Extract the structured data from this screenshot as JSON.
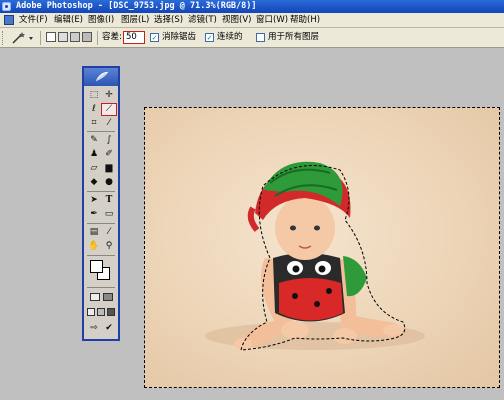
{
  "window": {
    "title": "Adobe Photoshop - [DSC_9753.jpg @ 71.3%(RGB/8)]"
  },
  "menu": [
    {
      "label": "文件(F)"
    },
    {
      "label": "编辑(E)"
    },
    {
      "label": "图像(I)"
    },
    {
      "label": "图层(L)"
    },
    {
      "label": "选择(S)"
    },
    {
      "label": "滤镜(T)"
    },
    {
      "label": "视图(V)"
    },
    {
      "label": "窗口(W)"
    },
    {
      "label": "帮助(H)"
    }
  ],
  "options": {
    "tolerance_label": "容差:",
    "tolerance_value": "50",
    "anti_alias": {
      "label": "消除锯齿",
      "checked": true
    },
    "contiguous": {
      "label": "连续的",
      "checked": true
    },
    "all_layers": {
      "label": "用于所有图层",
      "checked": false
    }
  },
  "tools": [
    {
      "icon": "marquee-icon",
      "glyph": "⬚"
    },
    {
      "icon": "move-icon",
      "glyph": "✛"
    },
    {
      "icon": "lasso-icon",
      "glyph": "ℓ"
    },
    {
      "icon": "magic-wand-icon",
      "glyph": "⟋"
    },
    {
      "icon": "crop-icon",
      "glyph": "⌗"
    },
    {
      "icon": "slice-icon",
      "glyph": "⁄"
    },
    {
      "icon": "healing-brush-icon",
      "glyph": "✎"
    },
    {
      "icon": "brush-icon",
      "glyph": "∫"
    },
    {
      "icon": "clone-stamp-icon",
      "glyph": "♟"
    },
    {
      "icon": "history-brush-icon",
      "glyph": "✐"
    },
    {
      "icon": "eraser-icon",
      "glyph": "▱"
    },
    {
      "icon": "gradient-icon",
      "glyph": "▆"
    },
    {
      "icon": "blur-icon",
      "glyph": "◆"
    },
    {
      "icon": "dodge-icon",
      "glyph": "●"
    },
    {
      "icon": "path-selection-icon",
      "glyph": "➤"
    },
    {
      "icon": "type-icon",
      "glyph": "T"
    },
    {
      "icon": "pen-icon",
      "glyph": "✒"
    },
    {
      "icon": "shape-icon",
      "glyph": "▭"
    },
    {
      "icon": "notes-icon",
      "glyph": "▤"
    },
    {
      "icon": "eyedropper-icon",
      "glyph": "⁄"
    },
    {
      "icon": "hand-icon",
      "glyph": "✋"
    },
    {
      "icon": "zoom-icon",
      "glyph": "⚲"
    }
  ],
  "colors": {
    "titlebar": "#1244b8",
    "toolbox_border": "#2040a8",
    "active_tool_outline": "#c42020",
    "canvas_background": "#ecd3b5",
    "hat_green": "#2f9a3a",
    "hat_red": "#d22a2a",
    "overalls_red": "#d82828",
    "skin": "#f2bf9a"
  }
}
